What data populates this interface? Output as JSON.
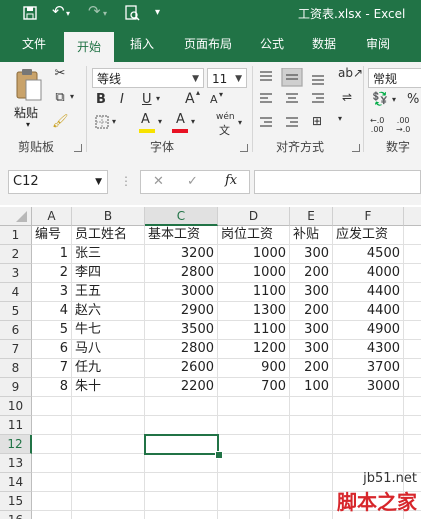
{
  "window": {
    "title": "工资表.xlsx - Excel",
    "quick_access": {
      "save_icon": "save-icon",
      "undo_icon": "undo-icon",
      "redo_icon": "redo-icon",
      "preview_icon": "print-preview-icon",
      "customize_icon": "customize-qat-icon"
    }
  },
  "tabs": [
    {
      "label": "文件",
      "active": false
    },
    {
      "label": "开始",
      "active": true
    },
    {
      "label": "插入",
      "active": false
    },
    {
      "label": "页面布局",
      "active": false
    },
    {
      "label": "公式",
      "active": false
    },
    {
      "label": "数据",
      "active": false
    },
    {
      "label": "审阅",
      "active": false
    }
  ],
  "ribbon": {
    "clipboard": {
      "paste_label": "粘贴",
      "group_label": "剪贴板"
    },
    "font": {
      "font_name": "等线",
      "font_size": "11",
      "bold": "B",
      "italic": "I",
      "underline": "U",
      "grow": "A",
      "shrink": "A",
      "fill_glyph": "A",
      "font_color_glyph": "A",
      "phonetic": "wén",
      "group_label": "字体"
    },
    "alignment": {
      "group_label": "对齐方式"
    },
    "number": {
      "format": "常规",
      "percent": "%",
      "group_label": "数字",
      "dec_inc": "←.0 .00",
      "dec_dec": ".00 →.0"
    }
  },
  "formula_bar": {
    "name_box": "C12",
    "cancel": "✕",
    "enter": "✓",
    "fx": "fx",
    "value": ""
  },
  "sheet": {
    "columns": [
      "A",
      "B",
      "C",
      "D",
      "E",
      "F"
    ],
    "selected_column": "C",
    "selected_row": 12,
    "active_cell": "C12",
    "row_numbers": [
      1,
      2,
      3,
      4,
      5,
      6,
      7,
      8,
      9,
      10,
      11,
      12,
      13,
      14,
      15,
      16
    ],
    "header_row": [
      "编号",
      "员工姓名",
      "基本工资",
      "岗位工资",
      "补贴",
      "应发工资"
    ],
    "rows": [
      [
        "1",
        "张三",
        "3200",
        "1000",
        "300",
        "4500"
      ],
      [
        "2",
        "李四",
        "2800",
        "1000",
        "200",
        "4000"
      ],
      [
        "3",
        "王五",
        "3000",
        "1100",
        "300",
        "4400"
      ],
      [
        "4",
        "赵六",
        "2900",
        "1300",
        "200",
        "4400"
      ],
      [
        "5",
        "牛七",
        "3500",
        "1100",
        "300",
        "4900"
      ],
      [
        "6",
        "马八",
        "2800",
        "1200",
        "300",
        "4300"
      ],
      [
        "7",
        "任九",
        "2600",
        "900",
        "200",
        "3700"
      ],
      [
        "8",
        "朱十",
        "2200",
        "700",
        "100",
        "3000"
      ]
    ]
  },
  "watermark": {
    "line1": "jb51.net",
    "line2": "脚本之家"
  }
}
